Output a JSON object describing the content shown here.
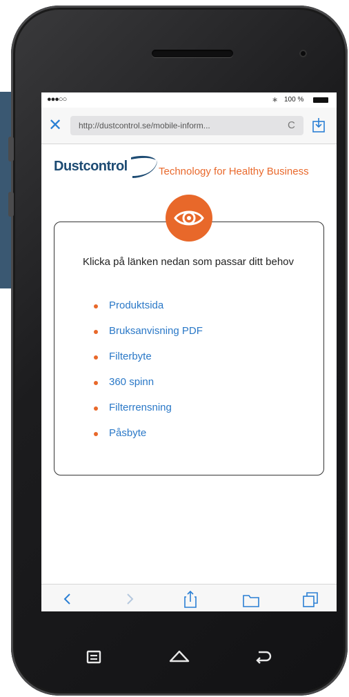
{
  "status_bar": {
    "signal": "●●●○○",
    "bluetooth": "∗",
    "battery_label": "100 %"
  },
  "browser": {
    "close_glyph": "✕",
    "url": "http://dustcontrol.se/mobile-inform...",
    "reload_glyph": "C"
  },
  "header": {
    "logo_text": "Dustcontrol",
    "tagline": "Technology for Healthy Business"
  },
  "content": {
    "intro": "Klicka på länken nedan som passar ditt behov",
    "links": [
      {
        "label": "Produktsida"
      },
      {
        "label": "Bruksanvisning PDF"
      },
      {
        "label": "Filterbyte"
      },
      {
        "label": "360 spinn"
      },
      {
        "label": "Filterrensning"
      },
      {
        "label": "Påsbyte"
      }
    ]
  },
  "colors": {
    "accent_orange": "#e8682a",
    "link_blue": "#2a78c7",
    "brand_navy": "#1d4b73",
    "ios_blue": "#2a7fd4"
  },
  "icons": {
    "toolbar": [
      "back-icon",
      "forward-icon",
      "share-icon",
      "bookmarks-icon",
      "tabs-icon"
    ],
    "android_nav": [
      "menu-icon",
      "home-icon",
      "back-icon"
    ]
  }
}
